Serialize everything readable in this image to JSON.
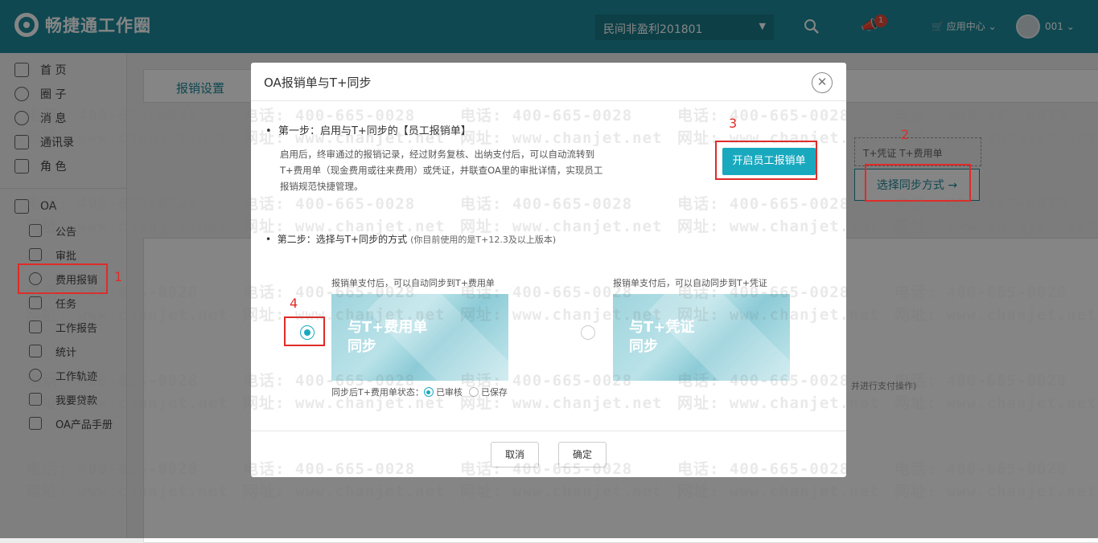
{
  "app": {
    "title": "畅捷通工作圈",
    "org": "民间非盈利201801",
    "notification_count": "1",
    "app_center": "应用中心",
    "user": "001"
  },
  "sidebar": {
    "items": [
      {
        "label": "首 页",
        "icon": "home-icon"
      },
      {
        "label": "圈 子",
        "icon": "circle-icon"
      },
      {
        "label": "消 息",
        "icon": "message-icon"
      },
      {
        "label": "通讯录",
        "icon": "contacts-icon"
      },
      {
        "label": "角 色",
        "icon": "role-icon"
      }
    ],
    "oa_label": "OA",
    "oa_items": [
      {
        "label": "公告",
        "icon": "notice-icon"
      },
      {
        "label": "审批",
        "icon": "approval-icon"
      },
      {
        "label": "费用报销",
        "icon": "expense-icon"
      },
      {
        "label": "任务",
        "icon": "task-icon"
      },
      {
        "label": "工作报告",
        "icon": "report-icon"
      },
      {
        "label": "统计",
        "icon": "chart-icon"
      },
      {
        "label": "工作轨迹",
        "icon": "location-icon"
      },
      {
        "label": "我要贷款",
        "icon": "loan-icon"
      },
      {
        "label": "OA产品手册",
        "icon": "manual-icon"
      }
    ]
  },
  "main": {
    "tab": "报销设置",
    "sync_tags": "T+凭证   T+费用单",
    "sync_method": "选择同步方式 →",
    "bg_note": "并进行支付操作)"
  },
  "modal": {
    "title": "OA报销单与T+同步",
    "step1": "第一步：启用与T+同步的【员工报销单】",
    "step1_desc": "启用后，终审通过的报销记录，经过财务复核、出纳支付后，可以自动流转到T+费用单（现金费用或往来费用）或凭证，并联查OA里的审批详情，实现员工报销规范快捷管理。",
    "enable_button": "开启员工报销单",
    "step2": "第二步：选择与T+同步的方式",
    "step2_hint": "(你目前使用的是T+12.3及以上版本)",
    "option1": {
      "caption": "报销单支付后，可以自动同步到T+费用单",
      "line1": "与T+费用单",
      "line2": "同步",
      "selected": true
    },
    "option2": {
      "caption": "报销单支付后，可以自动同步到T+凭证",
      "line1": "与T+凭证",
      "line2": "同步",
      "selected": false
    },
    "status_label": "同步后T+费用单状态：",
    "status_options": [
      "已审核",
      "已保存"
    ],
    "cancel": "取消",
    "confirm": "确定"
  },
  "annotations": [
    "1",
    "2",
    "3",
    "4"
  ],
  "watermark": {
    "phone": "电话: 400-665-0028",
    "site": "网址: www.chanjet.net"
  },
  "colors": {
    "brand": "#1d8b9c",
    "accent": "#19a9bf",
    "annotation": "#e02b27"
  }
}
